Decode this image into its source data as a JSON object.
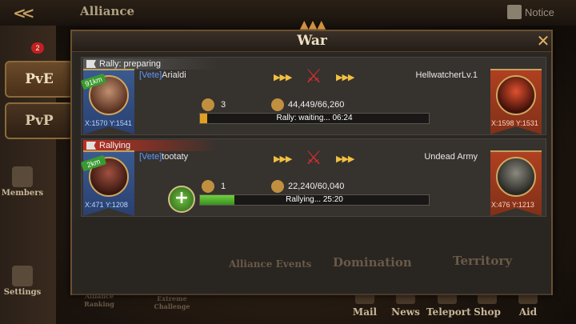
{
  "header": {
    "title": "Alliance",
    "notice_label": "Notice"
  },
  "sidebar": {
    "tabs": [
      {
        "label": "PvE",
        "badge": "2"
      },
      {
        "label": "PvP"
      }
    ],
    "items": [
      {
        "label": "Members"
      },
      {
        "label": "Settings"
      }
    ]
  },
  "background": {
    "items": [
      "Alliance Ranking",
      "Extreme Challenge",
      "Alliance Events",
      "Domination",
      "Territory"
    ]
  },
  "bottom_nav": [
    {
      "label": "Mail"
    },
    {
      "label": "News"
    },
    {
      "label": "Teleport"
    },
    {
      "label": "Shop"
    },
    {
      "label": "Aid"
    }
  ],
  "modal": {
    "title": "War",
    "rallies": [
      {
        "status": "Rally: preparing",
        "distance": "91km",
        "leader_tag": "[Vete]",
        "leader_name": "Arialdi",
        "leader_coord": "X:1570 Y:1541",
        "target_name": "HellwatcherLv.1",
        "target_coord": "X:1598 Y:1531",
        "members": "3",
        "power": "44,449/66,260",
        "progress_label": "Rally: waiting... 06:24",
        "progress": 0.03
      },
      {
        "status": "Rallying",
        "distance": "2km",
        "leader_tag": "[Vete]",
        "leader_name": "tootaty",
        "leader_coord": "X:471 Y:1208",
        "target_name": "Undead Army",
        "target_coord": "X:476 Y:1213",
        "members": "1",
        "power": "22,240/60,040",
        "progress_label": "Rallying... 25:20",
        "progress": 0.15
      }
    ]
  },
  "colors": {
    "accent": "#d0a860",
    "rallying": "#c03020",
    "progress_green": "#70d040",
    "progress_orange": "#e0a020"
  }
}
